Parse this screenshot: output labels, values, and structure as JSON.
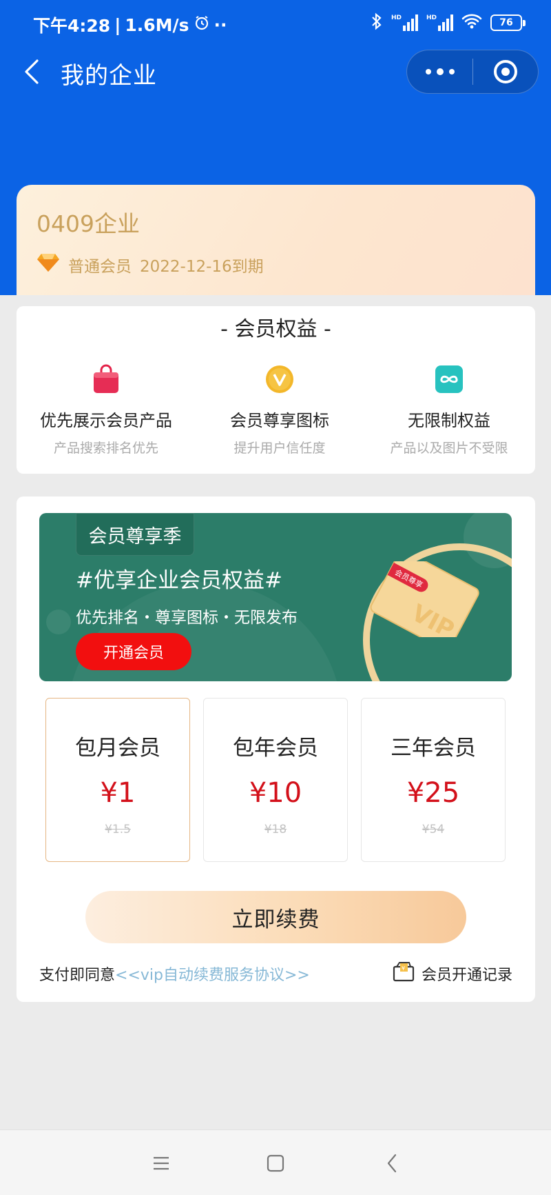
{
  "status_bar": {
    "time": "下午4:28",
    "speed": "1.6M/s",
    "dots": "··",
    "signal1_label": "HD",
    "signal2_label": "HD",
    "battery": "76"
  },
  "nav": {
    "title": "我的企业"
  },
  "company": {
    "name": "0409企业",
    "level": "普通会员",
    "expiry": "2022-12-16到期"
  },
  "benefits": {
    "title": "- 会员权益 -",
    "items": [
      {
        "name": "优先展示会员产品",
        "desc": "产品搜索排名优先",
        "icon": "shopping-bag-icon"
      },
      {
        "name": "会员尊享图标",
        "desc": "提升用户信任度",
        "icon": "vip-badge-icon"
      },
      {
        "name": "无限制权益",
        "desc": "产品以及图片不受限",
        "icon": "infinity-icon"
      }
    ]
  },
  "banner": {
    "tag": "会员尊享季",
    "headline": "#优享企业会员权益#",
    "subtitle": "优先排名・尊享图标・无限发布",
    "button": "开通会员",
    "card_ribbon": "会员尊享",
    "card_text": "VIP"
  },
  "plans": [
    {
      "name": "包月会员",
      "price": "¥1",
      "original": "¥1.5",
      "selected": true
    },
    {
      "name": "包年会员",
      "price": "¥10",
      "original": "¥18",
      "selected": false
    },
    {
      "name": "三年会员",
      "price": "¥25",
      "original": "¥54",
      "selected": false
    }
  ],
  "actions": {
    "renew": "立即续费",
    "agreement_prefix": "支付即同意",
    "agreement_link": "<<vip自动续费服务协议>>",
    "records": "会员开通记录"
  },
  "colors": {
    "header_blue": "#0b63e5",
    "gold_text": "#c9a15c",
    "price_red": "#d3101a",
    "banner_green": "#2c7d69",
    "link_blue": "#86b8d6"
  }
}
